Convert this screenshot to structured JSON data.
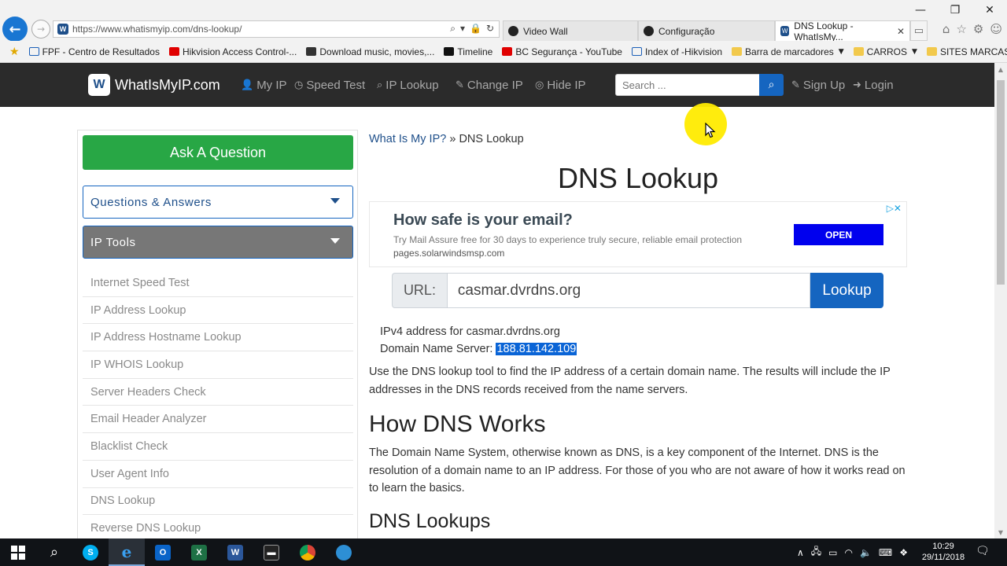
{
  "window": {
    "minimize_icon": "minimize-icon",
    "minimize_glyph": "—",
    "restore_glyph": "❐",
    "close_glyph": "✕"
  },
  "browser": {
    "url_prefix": "https://www.",
    "url_domain": "whatismyip.com",
    "url_path": "/dns-lookup/",
    "tabs": [
      {
        "label": "Video Wall",
        "active": false
      },
      {
        "label": "Configuração",
        "active": false
      },
      {
        "label": "DNS Lookup - WhatIsMy...",
        "active": true
      }
    ],
    "bookmarks": [
      {
        "label": "FPF - Centro de Resultados",
        "color": "#1b5fb8"
      },
      {
        "label": "Hikvision Access Control-...",
        "color": "#e00000"
      },
      {
        "label": "Download music, movies,...",
        "color": "#333333"
      },
      {
        "label": "Timeline",
        "color": "#111111"
      },
      {
        "label": "BC Segurança - YouTube",
        "color": "#e00000"
      },
      {
        "label": "Index of -Hikvision",
        "color": "#1b5fb8"
      },
      {
        "label": "Barra de marcadores",
        "color": "#f2c94c",
        "dropdown": true
      },
      {
        "label": "CARROS",
        "color": "#f2c94c",
        "dropdown": true
      },
      {
        "label": "SITES MARCAS",
        "color": "#f2c94c",
        "dropdown": true
      }
    ]
  },
  "site": {
    "logo_text": "WhatIsMyIP.com",
    "logo_letter": "W",
    "nav": [
      {
        "label": "My IP",
        "icon": "user-icon",
        "glyph": "👤"
      },
      {
        "label": "Speed Test",
        "icon": "dashboard-icon",
        "glyph": "◷"
      },
      {
        "label": "IP Lookup",
        "icon": "search-icon",
        "glyph": "⌕"
      },
      {
        "label": "Change IP",
        "icon": "edit-icon",
        "glyph": "✎"
      },
      {
        "label": "Hide IP",
        "icon": "eye-slash-icon",
        "glyph": "◎"
      }
    ],
    "search_placeholder": "Search ...",
    "sign_up": "Sign Up",
    "login": "Login"
  },
  "sidebar": {
    "ask_button": "Ask A Question",
    "qa_dropdown": "Questions & Answers",
    "tools_dropdown": "IP Tools",
    "tools": [
      "Internet Speed Test",
      "IP Address Lookup",
      "IP Address Hostname Lookup",
      "IP WHOIS Lookup",
      "Server Headers Check",
      "Email Header Analyzer",
      "Blacklist Check",
      "User Agent Info",
      "DNS Lookup",
      "Reverse DNS Lookup"
    ]
  },
  "main": {
    "breadcrumb_home": "What Is My IP?",
    "breadcrumb_sep": "»",
    "breadcrumb_current": "DNS Lookup",
    "title": "DNS Lookup",
    "ad": {
      "heading": "How safe is your email?",
      "body": "Try Mail Assure free for 30 days to experience truly secure, reliable email protection",
      "domain": "pages.solarwindsmsp.com",
      "button": "OPEN"
    },
    "url_label": "URL:",
    "url_value": "casmar.dvrdns.org",
    "lookup_button": "Lookup",
    "result_line1": "IPv4 address for casmar.dvrdns.org",
    "result_line2_label": "Domain Name Server:",
    "result_ip": "188.81.142.109",
    "intro": "Use the DNS lookup tool to find the IP address of a certain domain name. The results will include the IP addresses in the DNS records received from the name servers.",
    "h2_how": "How DNS Works",
    "how_para": "The Domain Name System, otherwise known as DNS, is a key component of the Internet. DNS is the resolution of a domain name to an IP address. For those of you who are not aware of how it works read on to learn the basics.",
    "h2_lookups": "DNS Lookups"
  },
  "taskbar": {
    "time": "10:29",
    "date": "29/11/2018"
  },
  "colors": {
    "nav_bg": "#2b2b2b",
    "accent_blue": "#1565c0",
    "ask_green": "#28a745",
    "tools_gray": "#777777"
  }
}
